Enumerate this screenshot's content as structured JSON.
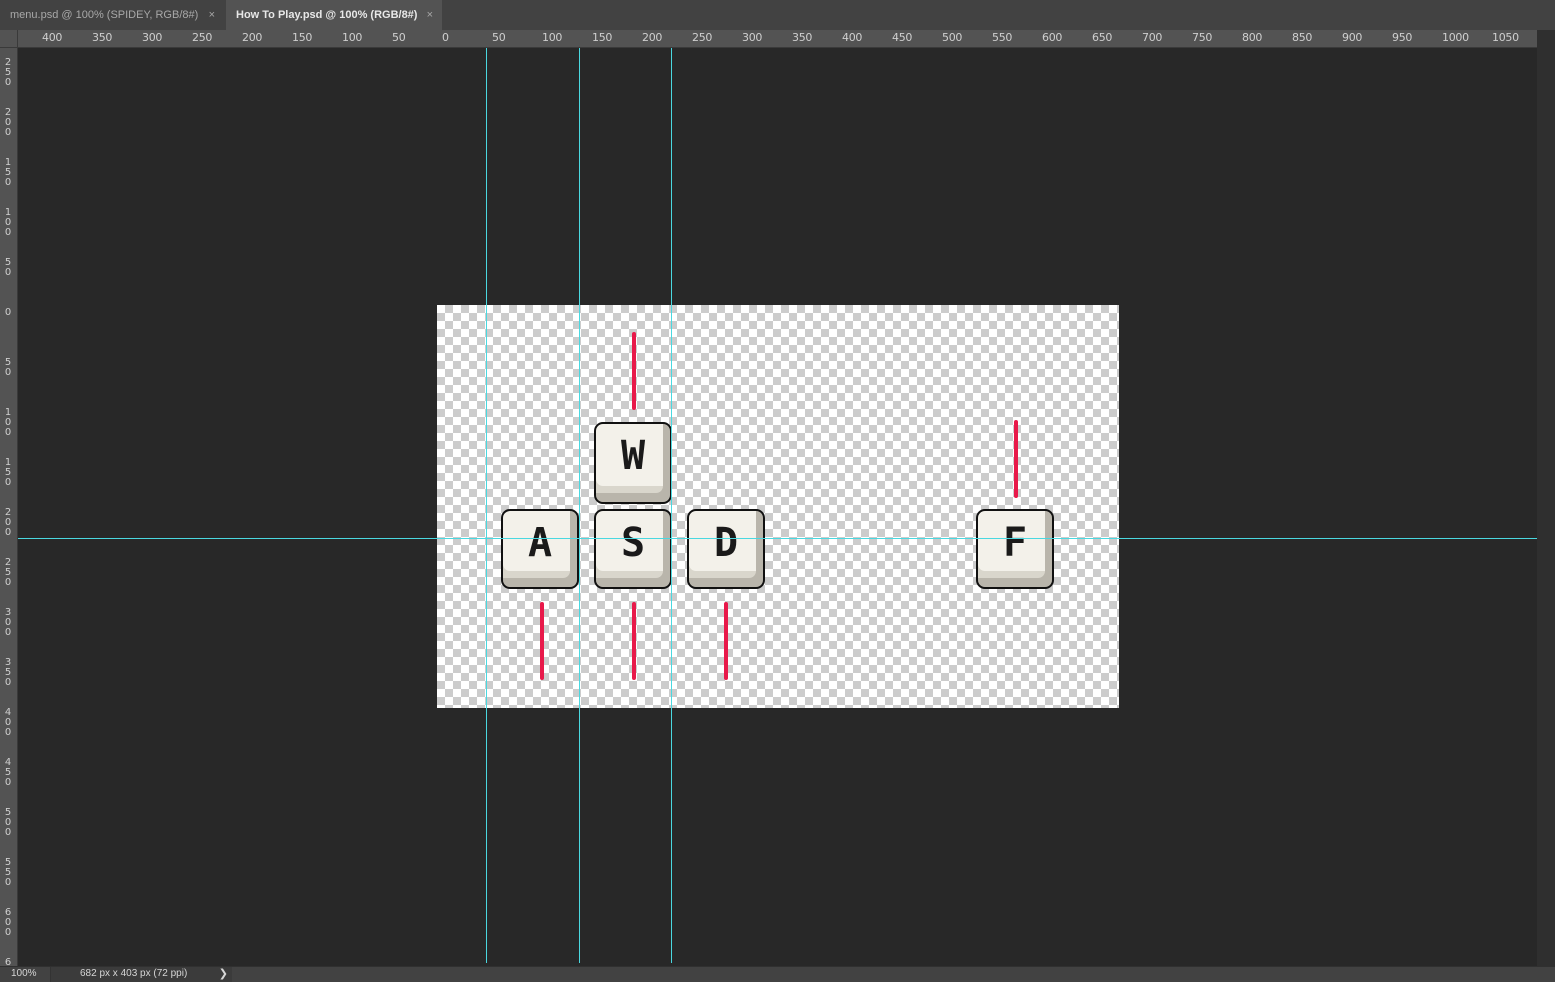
{
  "tabs": [
    {
      "label": "menu.psd @ 100% (SPIDEY, RGB/8#)",
      "close": "×"
    },
    {
      "label": "How To Play.psd @ 100% (RGB/8#)",
      "close": "×"
    }
  ],
  "ruler_top_labels": [
    "400",
    "350",
    "300",
    "250",
    "200",
    "150",
    "100",
    "50",
    "0",
    "50",
    "100",
    "150",
    "200",
    "250",
    "300",
    "350",
    "400",
    "450",
    "500",
    "550",
    "600",
    "650",
    "700",
    "750",
    "800",
    "850",
    "900",
    "950",
    "1000",
    "1050"
  ],
  "ruler_left_labels": [
    "250",
    "200",
    "150",
    "100",
    "50",
    "0",
    "50",
    "100",
    "150",
    "200",
    "250",
    "300",
    "350",
    "400",
    "450",
    "500",
    "550",
    "600",
    "6"
  ],
  "keys": [
    {
      "name": "w",
      "letter": "W"
    },
    {
      "name": "a",
      "letter": "A"
    },
    {
      "name": "s",
      "letter": "S"
    },
    {
      "name": "d",
      "letter": "D"
    },
    {
      "name": "f",
      "letter": "F"
    }
  ],
  "status": {
    "zoom": "100%",
    "doc_info": "682 px x 403 px (72 ppi)",
    "arrow": "❯"
  },
  "colors": {
    "guide": "#4ad8e0",
    "accent_line": "#e8194a",
    "workspace": "#282828"
  }
}
